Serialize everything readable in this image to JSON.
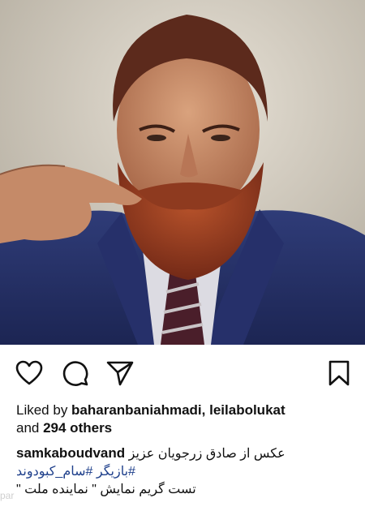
{
  "post": {
    "image_alt": "Portrait of a bearded man in a navy suit twirling his mustache",
    "actions": {
      "like_icon": "heart-icon",
      "comment_icon": "comment-icon",
      "share_icon": "paper-plane-icon",
      "save_icon": "bookmark-icon"
    },
    "likes": {
      "prefix": "Liked by ",
      "user1": "baharanbaniahmadi",
      "separator": ", ",
      "user2": "leilabolukat",
      "mid": " and ",
      "others": "294 others"
    },
    "caption": {
      "username": "samkaboudvand",
      "text_line1": "عکس از صادق زرجویان عزیز",
      "hashtag1": "#بازیگر",
      "hashtag2": "#سام_کبودوند",
      "text_line3": "تست گریم نمایش \" نماینده ملت \""
    },
    "watermark": "par"
  },
  "colors": {
    "hashtag": "#1e3f8b",
    "text": "#111111"
  }
}
